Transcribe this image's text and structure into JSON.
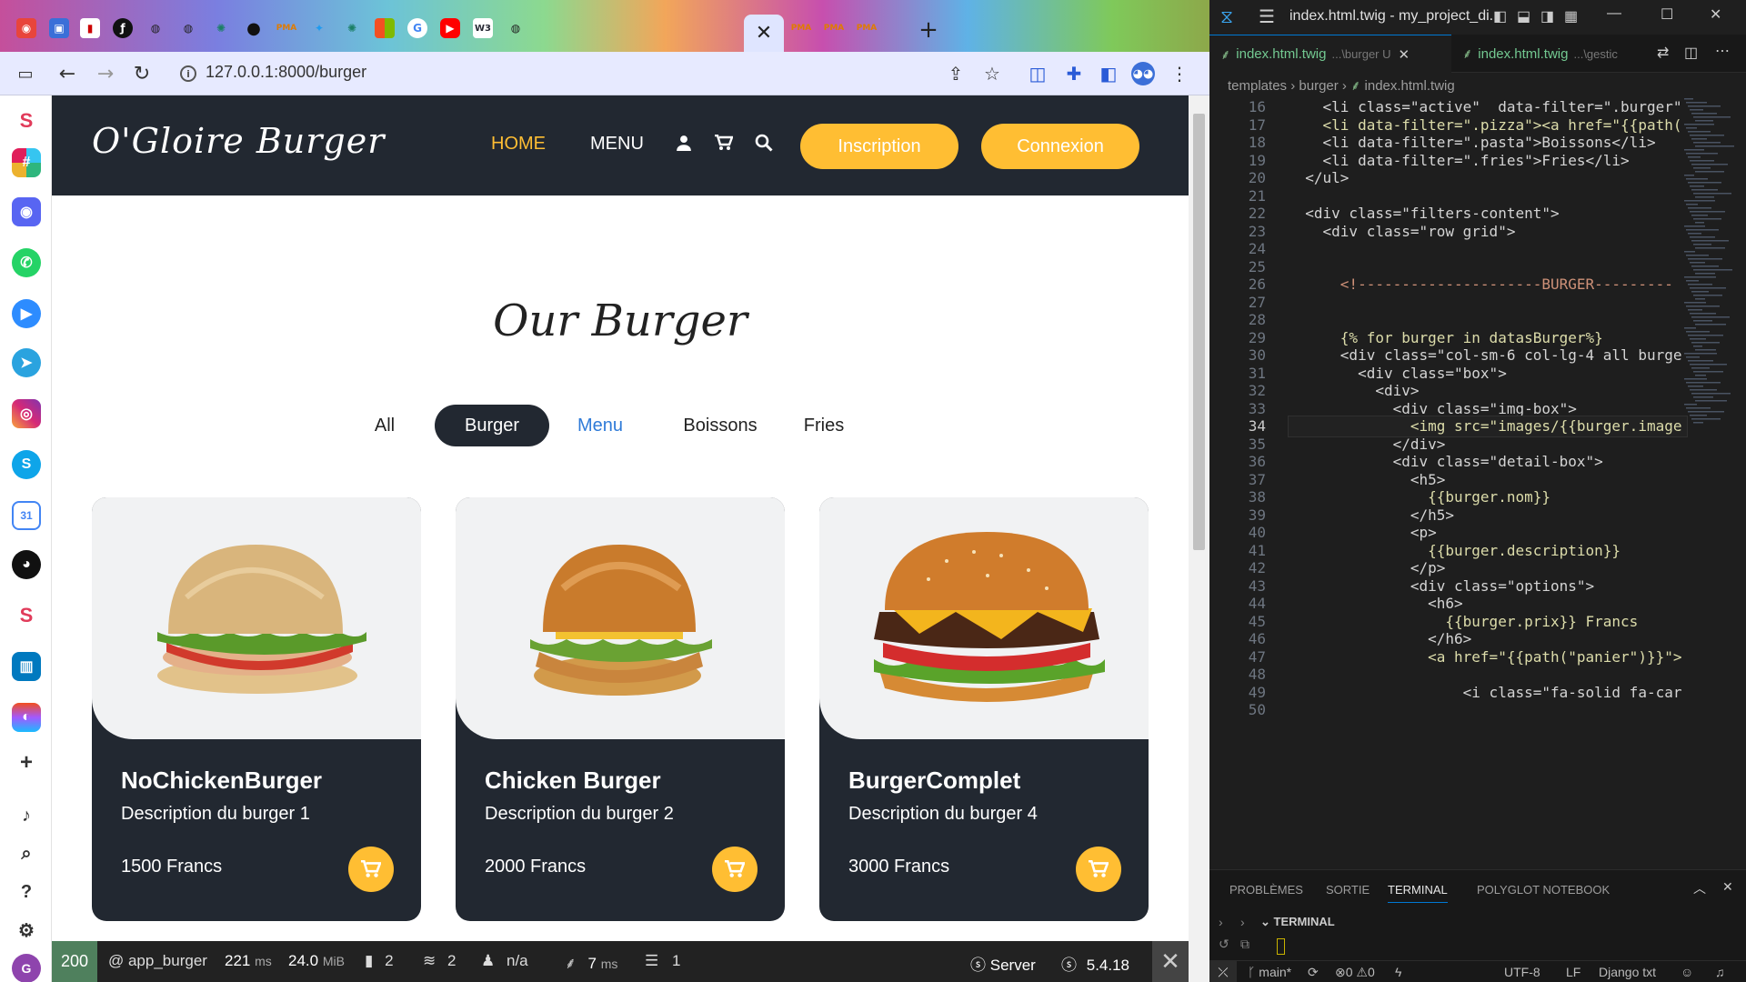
{
  "browser": {
    "url": "127.0.0.1:8000/burger",
    "active_tab_close": "✕",
    "new_tab": "+"
  },
  "site": {
    "brand": "O'Gloire Burger",
    "nav": {
      "home": "HOME",
      "menu": "MENU"
    },
    "buttons": {
      "signup": "Inscription",
      "login": "Connexion"
    },
    "section_title": "Our Burger",
    "filters": [
      "All",
      "Burger",
      "Menu",
      "Boissons",
      "Fries"
    ],
    "active_filter": "Burger",
    "products": [
      {
        "name": "NoChickenBurger",
        "description": "Description du burger 1",
        "price": "1500 Francs"
      },
      {
        "name": "Chicken Burger",
        "description": "Description du burger 2",
        "price": "2000 Francs"
      },
      {
        "name": "BurgerComplet",
        "description": "Description du burger 4",
        "price": "3000 Francs"
      }
    ],
    "accent_color": "#ffbe33",
    "dark_color": "#222831"
  },
  "symfony_toolbar": {
    "status": "200",
    "route": "@ app_burger",
    "time": "221",
    "time_unit": "ms",
    "memory": "24.0",
    "memory_unit": "MiB",
    "logs": "2",
    "cache": "2",
    "user": "n/a",
    "twig_time": "7",
    "twig_unit": "ms",
    "db": "1",
    "server": "Server",
    "version": "5.4.18"
  },
  "vscode": {
    "title": "index.html.twig - my_project_di...",
    "tabs": [
      {
        "label": "index.html.twig",
        "path": "...\\burger U"
      },
      {
        "label": "index.html.twig",
        "path": "...\\gestic"
      }
    ],
    "breadcrumb": [
      "templates",
      "burger",
      "index.html.twig"
    ],
    "current_line": 34,
    "lines": [
      {
        "n": "16",
        "t": "    <li class=\"active\"  data-filter=\".burger\""
      },
      {
        "n": "17",
        "t": "    <li data-filter=\".pizza\"><a href=\"{{path("
      },
      {
        "n": "18",
        "t": "    <li data-filter=\".pasta\">Boissons</li>"
      },
      {
        "n": "19",
        "t": "    <li data-filter=\".fries\">Fries</li>"
      },
      {
        "n": "20",
        "t": "  </ul>"
      },
      {
        "n": "21",
        "t": ""
      },
      {
        "n": "22",
        "t": "  <div class=\"filters-content\">"
      },
      {
        "n": "23",
        "t": "    <div class=\"row grid\">"
      },
      {
        "n": "24",
        "t": ""
      },
      {
        "n": "25",
        "t": ""
      },
      {
        "n": "26",
        "t": "      <!---------------------BURGER---------"
      },
      {
        "n": "27",
        "t": ""
      },
      {
        "n": "28",
        "t": ""
      },
      {
        "n": "29",
        "t": "      {% for burger in datasBurger%}"
      },
      {
        "n": "30",
        "t": "      <div class=\"col-sm-6 col-lg-4 all burge"
      },
      {
        "n": "31",
        "t": "        <div class=\"box\">"
      },
      {
        "n": "32",
        "t": "          <div>"
      },
      {
        "n": "33",
        "t": "            <div class=\"img-box\">"
      },
      {
        "n": "34",
        "t": "              <img src=\"images/{{burger.image"
      },
      {
        "n": "35",
        "t": "            </div>"
      },
      {
        "n": "36",
        "t": "            <div class=\"detail-box\">"
      },
      {
        "n": "37",
        "t": "              <h5>"
      },
      {
        "n": "38",
        "t": "                {{burger.nom}}"
      },
      {
        "n": "39",
        "t": "              </h5>"
      },
      {
        "n": "40",
        "t": "              <p>"
      },
      {
        "n": "41",
        "t": "                {{burger.description}}"
      },
      {
        "n": "42",
        "t": "              </p>"
      },
      {
        "n": "43",
        "t": "              <div class=\"options\">"
      },
      {
        "n": "44",
        "t": "                <h6>"
      },
      {
        "n": "45",
        "t": "                  {{burger.prix}} Francs"
      },
      {
        "n": "46",
        "t": "                </h6>"
      },
      {
        "n": "47",
        "t": "                <a href=\"{{path(\"panier\")}}\">"
      },
      {
        "n": "48",
        "t": ""
      },
      {
        "n": "49",
        "t": "                    <i class=\"fa-solid fa-car"
      },
      {
        "n": "50",
        "t": ""
      }
    ],
    "panel_tabs": [
      "PROBLÈMES",
      "SORTIE",
      "TERMINAL",
      "POLYGLOT NOTEBOOK"
    ],
    "active_panel": "TERMINAL",
    "terminal_label": "TERMINAL",
    "status": {
      "branch": "main*",
      "errors": "0",
      "warnings": "0",
      "encoding": "UTF-8",
      "eol": "LF",
      "language": "Django txt"
    }
  }
}
